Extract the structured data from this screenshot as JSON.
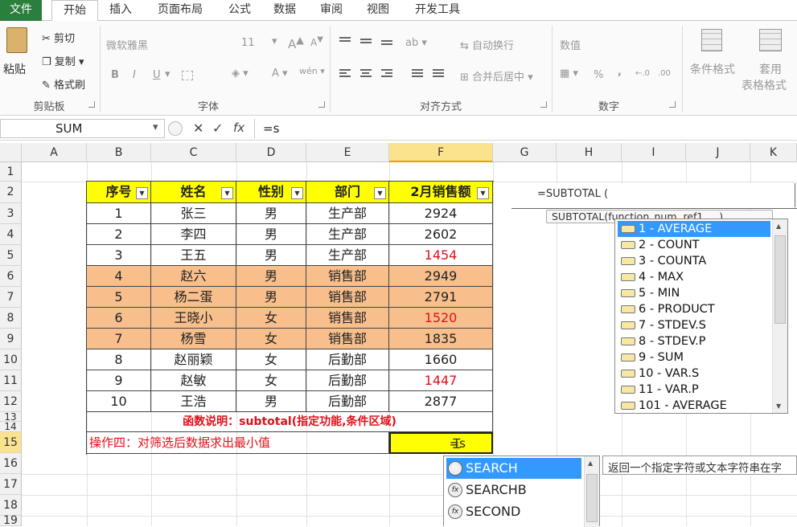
{
  "tabs": [
    "文件",
    "开始",
    "插入",
    "页面布局",
    "公式",
    "数据",
    "审阅",
    "视图",
    "开发工具"
  ],
  "ribbon": {
    "clipboard": {
      "paste": "粘贴",
      "cut": "剪切",
      "copy": "复制",
      "painter": "格式刷",
      "group": "剪贴板"
    },
    "font": {
      "name": "微软雅黑",
      "size": "11",
      "bold": "B",
      "italic": "I",
      "underline": "U",
      "grow": "A",
      "shrink": "A",
      "phonetic": "wén",
      "group": "字体"
    },
    "align": {
      "wrap": "自动换行",
      "merge": "合并后居中",
      "group": "对齐方式"
    },
    "number": {
      "format": "数值",
      "percent": "%",
      "comma": ",",
      "group": "数字"
    },
    "styles": {
      "conditional": "条件格式",
      "table_line1": "套用",
      "table_line2": "表格格式"
    }
  },
  "formula_bar": {
    "name_box": "SUM",
    "fx": "fx",
    "cancel": "✕",
    "enter": "✓",
    "value": "=s"
  },
  "columns": [
    "A",
    "B",
    "C",
    "D",
    "E",
    "F",
    "G",
    "H",
    "I",
    "J",
    "K"
  ],
  "rows": [
    "1",
    "2",
    "3",
    "4",
    "5",
    "6",
    "7",
    "8",
    "9",
    "10",
    "11",
    "12",
    "13",
    "14",
    "15",
    "16",
    "17",
    "18",
    "19"
  ],
  "table": {
    "headers": [
      "序号",
      "姓名",
      "性别",
      "部门",
      "2月销售额"
    ],
    "rows": [
      [
        "1",
        "张三",
        "男",
        "生产部",
        "2924"
      ],
      [
        "2",
        "李四",
        "男",
        "生产部",
        "2602"
      ],
      [
        "3",
        "王五",
        "男",
        "生产部",
        "1454"
      ],
      [
        "4",
        "赵六",
        "男",
        "销售部",
        "2949"
      ],
      [
        "5",
        "杨二蛋",
        "男",
        "销售部",
        "2791"
      ],
      [
        "6",
        "王晓小",
        "女",
        "销售部",
        "1520"
      ],
      [
        "7",
        "杨雪",
        "女",
        "销售部",
        "1835"
      ],
      [
        "8",
        "赵丽颖",
        "女",
        "后勤部",
        "1660"
      ],
      [
        "9",
        "赵敏",
        "女",
        "后勤部",
        "1447"
      ],
      [
        "10",
        "王浩",
        "男",
        "后勤部",
        "2877"
      ]
    ],
    "highlight_color": "#f8bf8c",
    "header_color": "#ffff00",
    "red_color": "#e0101a"
  },
  "note": "函数说明：subtotal(指定功能,条件区域)",
  "op_text": "操作四：对筛选后数据求出最小值",
  "active_cell": {
    "value": "=s"
  },
  "subtotal_box": {
    "formula": "=SUBTOTAL (",
    "tooltip": "SUBTOTAL(function_num, ref1, ...)",
    "options": [
      "1 - AVERAGE",
      "2 - COUNT",
      "3 - COUNTA",
      "4 - MAX",
      "5 - MIN",
      "6 - PRODUCT",
      "7 - STDEV.S",
      "8 - STDEV.P",
      "9 - SUM",
      "10 - VAR.S",
      "11 - VAR.P",
      "101 - AVERAGE"
    ]
  },
  "autocomplete": {
    "items": [
      "SEARCH",
      "SEARCHB",
      "SECOND"
    ],
    "description": "返回一个指定字符或文本字符串在字"
  }
}
